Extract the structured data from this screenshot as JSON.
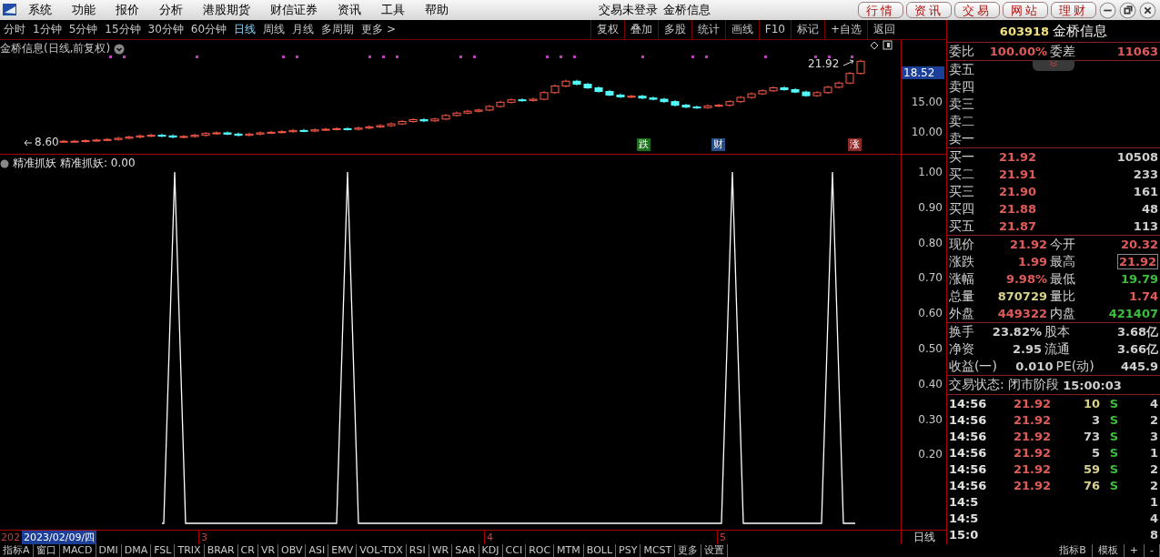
{
  "menubar": {
    "menus": [
      "系统",
      "功能",
      "报价",
      "分析",
      "港股期货",
      "财信证券",
      "资讯",
      "工具",
      "帮助"
    ],
    "title": [
      "交易未登录",
      "金桥信息"
    ],
    "buttons": [
      "行情",
      "资讯",
      "交易",
      "网站",
      "理财"
    ]
  },
  "periods": [
    {
      "label": "分时",
      "selected": false
    },
    {
      "label": "1分钟",
      "selected": false
    },
    {
      "label": "5分钟",
      "selected": false
    },
    {
      "label": "15分钟",
      "selected": false
    },
    {
      "label": "30分钟",
      "selected": false
    },
    {
      "label": "60分钟",
      "selected": false
    },
    {
      "label": "日线",
      "selected": true
    },
    {
      "label": "周线",
      "selected": false
    },
    {
      "label": "月线",
      "selected": false
    },
    {
      "label": "多周期",
      "selected": false
    },
    {
      "label": "更多 >",
      "selected": false
    }
  ],
  "chart_tools": [
    "复权",
    "叠加",
    "多股",
    "统计",
    "画线",
    "F10",
    "标记",
    "+自选",
    "返回"
  ],
  "kline": {
    "title": "金桥信息(日线,前复权)",
    "high_label": "21.92",
    "low_label": "8.60",
    "price_labels": [
      {
        "text": "18.52",
        "current": true
      },
      {
        "text": "15.00",
        "current": false
      },
      {
        "text": "10.00",
        "current": false
      }
    ],
    "tags": [
      {
        "text": "跌",
        "color": "#1f6e1f"
      },
      {
        "text": "财",
        "color": "#274f86"
      },
      {
        "text": "涨",
        "color": "#8c2a2a"
      }
    ]
  },
  "indicator": {
    "name": "精准抓妖",
    "reading": "精准抓妖: 0.00",
    "axis_labels": [
      "1.00",
      "0.90",
      "0.80",
      "0.70",
      "0.60",
      "0.50",
      "0.40",
      "0.30",
      "0.20"
    ]
  },
  "date_axis": {
    "labels": [
      "202",
      "3",
      "4",
      "5"
    ],
    "cursor_date": "2023/02/09/四",
    "period": "日线"
  },
  "quote": {
    "code": "603918",
    "name": "金桥信息",
    "ratio": [
      {
        "label": "委比",
        "value": "100.00%"
      },
      {
        "label": "委差",
        "value": "11063"
      }
    ],
    "sells": [
      "卖五",
      "卖四",
      "卖三",
      "卖二",
      "卖一"
    ],
    "buys": [
      {
        "label": "买一",
        "price": "21.92",
        "volume": "10508"
      },
      {
        "label": "买二",
        "price": "21.91",
        "volume": "233"
      },
      {
        "label": "买三",
        "price": "21.90",
        "volume": "161"
      },
      {
        "label": "买四",
        "price": "21.88",
        "volume": "48"
      },
      {
        "label": "买五",
        "price": "21.87",
        "volume": "113"
      }
    ],
    "stats": [
      {
        "label": "现价",
        "value": "21.92",
        "color": "#e05a5a",
        "boxed": false
      },
      {
        "label": "今开",
        "value": "20.32",
        "color": "#e05a5a",
        "boxed": false
      },
      {
        "label": "涨跌",
        "value": "1.99",
        "color": "#e05a5a",
        "boxed": false
      },
      {
        "label": "最高",
        "value": "21.92",
        "color": "#e05a5a",
        "boxed": true
      },
      {
        "label": "涨幅",
        "value": "9.98%",
        "color": "#e05a5a",
        "boxed": false
      },
      {
        "label": "最低",
        "value": "19.79",
        "color": "#3cbf3c",
        "boxed": false
      },
      {
        "label": "总量",
        "value": "870729",
        "color": "#d8d08a",
        "boxed": false
      },
      {
        "label": "量比",
        "value": "1.74",
        "color": "#e05a5a",
        "boxed": false
      },
      {
        "label": "外盘",
        "value": "449322",
        "color": "#e05a5a",
        "boxed": false
      },
      {
        "label": "内盘",
        "value": "421407",
        "color": "#3cbf3c",
        "boxed": false
      }
    ],
    "stats2": [
      {
        "label": "换手",
        "value": "23.82%"
      },
      {
        "label": "股本",
        "value": "3.68亿"
      },
      {
        "label": "净资",
        "value": "2.95"
      },
      {
        "label": "流通",
        "value": "3.66亿"
      },
      {
        "label": "收益(一)",
        "value": "0.010"
      },
      {
        "label": "PE(动)",
        "value": "445.9"
      }
    ],
    "status": {
      "label": "交易状态: 闭市阶段",
      "time": "15:00:03"
    },
    "trades": [
      {
        "time": "14:56",
        "price": "21.92",
        "volume": "10",
        "color": "#d8d08a",
        "side": "S",
        "count": "4"
      },
      {
        "time": "14:56",
        "price": "21.92",
        "volume": "3",
        "color": "#d0d0d0",
        "side": "S",
        "count": "2"
      },
      {
        "time": "14:56",
        "price": "21.92",
        "volume": "73",
        "color": "#d0d0d0",
        "side": "S",
        "count": "3"
      },
      {
        "time": "14:56",
        "price": "21.92",
        "volume": "5",
        "color": "#d0d0d0",
        "side": "S",
        "count": "1"
      },
      {
        "time": "14:56",
        "price": "21.92",
        "volume": "59",
        "color": "#d8d08a",
        "side": "S",
        "count": "2"
      },
      {
        "time": "14:56",
        "price": "21.92",
        "volume": "76",
        "color": "#d8d08a",
        "side": "S",
        "count": "2"
      },
      {
        "time": "14:5",
        "count": "1"
      },
      {
        "time": "14:5",
        "count": "4"
      },
      {
        "time": "15:0",
        "count": "8"
      }
    ]
  },
  "bottom_tabs": [
    "指标A",
    "窗口",
    "MACD",
    "DMI",
    "DMA",
    "FSL",
    "TRIX",
    "BRAR",
    "CR",
    "VR",
    "OBV",
    "ASI",
    "EMV",
    "VOL-TDX",
    "RSI",
    "WR",
    "SAR",
    "KDJ",
    "CCI",
    "ROC",
    "MTM",
    "BOLL",
    "PSY",
    "MCST",
    "更多",
    "设置"
  ],
  "bottom_right": [
    "指标B",
    "模板",
    "+",
    "-"
  ]
}
